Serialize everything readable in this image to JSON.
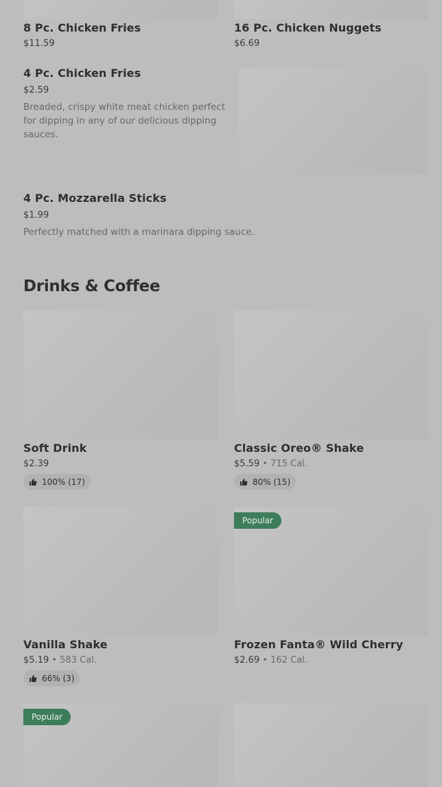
{
  "items_top": [
    {
      "name": "8 Pc. Chicken Fries",
      "price": "$11.59"
    },
    {
      "name": "16 Pc. Chicken Nuggets",
      "price": "$6.69"
    }
  ],
  "item_4pc_fries": {
    "name": "4 Pc. Chicken Fries",
    "price": "$2.59",
    "description": "Breaded, crispy white meat chicken perfect for dipping in any of our delicious dipping sauces."
  },
  "item_mozzarella": {
    "name": "4 Pc. Mozzarella Sticks",
    "price": "$1.99",
    "description": "Perfectly matched with a marinara dipping sauce."
  },
  "drinks_section": {
    "title": "Drinks & Coffee",
    "items": [
      {
        "name": "Soft Drink",
        "price": "$2.39",
        "calories": "",
        "rating": "100% (17)",
        "badge": ""
      },
      {
        "name": "Classic Oreo® Shake",
        "price": "$5.59",
        "calories": "715 Cal.",
        "rating": "80% (15)",
        "badge": ""
      },
      {
        "name": "Vanilla Shake",
        "price": "$5.19",
        "calories": "583 Cal.",
        "rating": "66% (3)",
        "badge": ""
      },
      {
        "name": "Frozen Fanta® Wild Cherry",
        "price": "$2.69",
        "calories": "162 Cal.",
        "rating": "",
        "badge": "Popular"
      }
    ],
    "next_row_badge": "Popular",
    "separator": "•"
  },
  "icons": {
    "rating": "thumbs-up-icon"
  },
  "colors": {
    "badge_bg": "#3d7d5a",
    "overlay_bg": "#bdbdbd"
  }
}
